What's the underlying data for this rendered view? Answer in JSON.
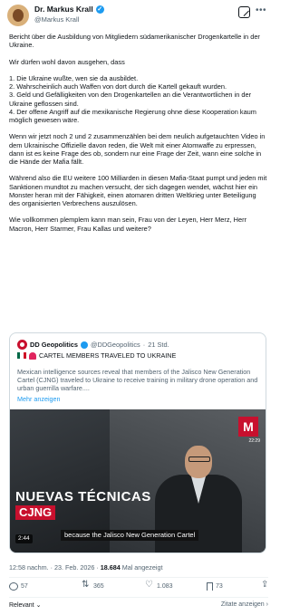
{
  "author": {
    "name": "Dr. Markus Krall",
    "handle": "@Markus Krall"
  },
  "post": {
    "text": "Bericht über die Ausbildung von Mitgliedern südamerikanischer Drogenkartelle in der Ukraine.\n\nWir dürfen wohl davon ausgehen, dass\n\n1. Die Ukraine wußte, wen sie da ausbildet.\n2. Wahrscheinlich auch Waffen von dort durch die Kartell gekauft wurden.\n3. Geld und Gefälligkeiten von den Drogenkartellen an die Verantwortlichen in der Ukraine geflossen sind.\n4. Der offene Angriff auf die mexikanische Regierung ohne diese Kooperation kaum möglich gewesen wäre.\n\nWenn wir jetzt noch 2 und 2 zusammenzählen bei dem neulich aufgetauchten Video in dem Ukrainische Offizielle davon reden, die Welt mit einer Atomwaffe zu erpressen, dann ist es keine Frage des ob, sondern nur eine Frage der Zeit, wann eine solche in die Hände der Mafia fällt.\n\nWährend also die EU weitere 100 Milliarden in diesen Mafia-Staat pumpt und jeden mit Sanktionen mundtot zu machen versucht, der sich dagegen wendet, wächst hier ein Monster heran mit der Fähigkeit, einen atomaren dritten Weltkrieg unter Beteiligung des organisierten Verbrechens auszulösen.\n\nWie vollkommen plemplem kann man sein, Frau von der Leyen, Herr Merz, Herr Macron, Herr Starmer, Frau Kallas und weitere?"
  },
  "quote": {
    "name": "DD Geopolitics",
    "handle": "@DDGeopolitics",
    "date": "21 Std.",
    "headline": "CARTEL MEMBERS TRAVELED TO UKRAINE",
    "text": "Mexican intelligence sources reveal that members of the Jalisco New Generation Cartel (CJNG) traveled to Ukraine to receive training in military drone operation and urban guerrilla warfare....",
    "more": "Mehr anzeigen",
    "video": {
      "overlay_title": "NUEVAS TÉCNICAS",
      "overlay_tag": "CJNG",
      "caption": "because the Jalisco New Generation Cartel",
      "duration": "2:44",
      "channel_logo": "M",
      "clock": "22:29"
    }
  },
  "meta": {
    "time": "12:58 nachm.",
    "date": "23. Feb. 2026",
    "views": "18.684",
    "views_label": "Mal angezeigt"
  },
  "actions": {
    "replies": "57",
    "reposts": "365",
    "likes": "1.083",
    "bookmarks": "73"
  },
  "footer": {
    "sort": "Relevant",
    "quotes": "Zitate anzeigen"
  },
  "colors": {
    "accent": "#1d9bf0",
    "muted": "#536471",
    "border": "#cfd9de",
    "brand_red": "#c8102e"
  }
}
